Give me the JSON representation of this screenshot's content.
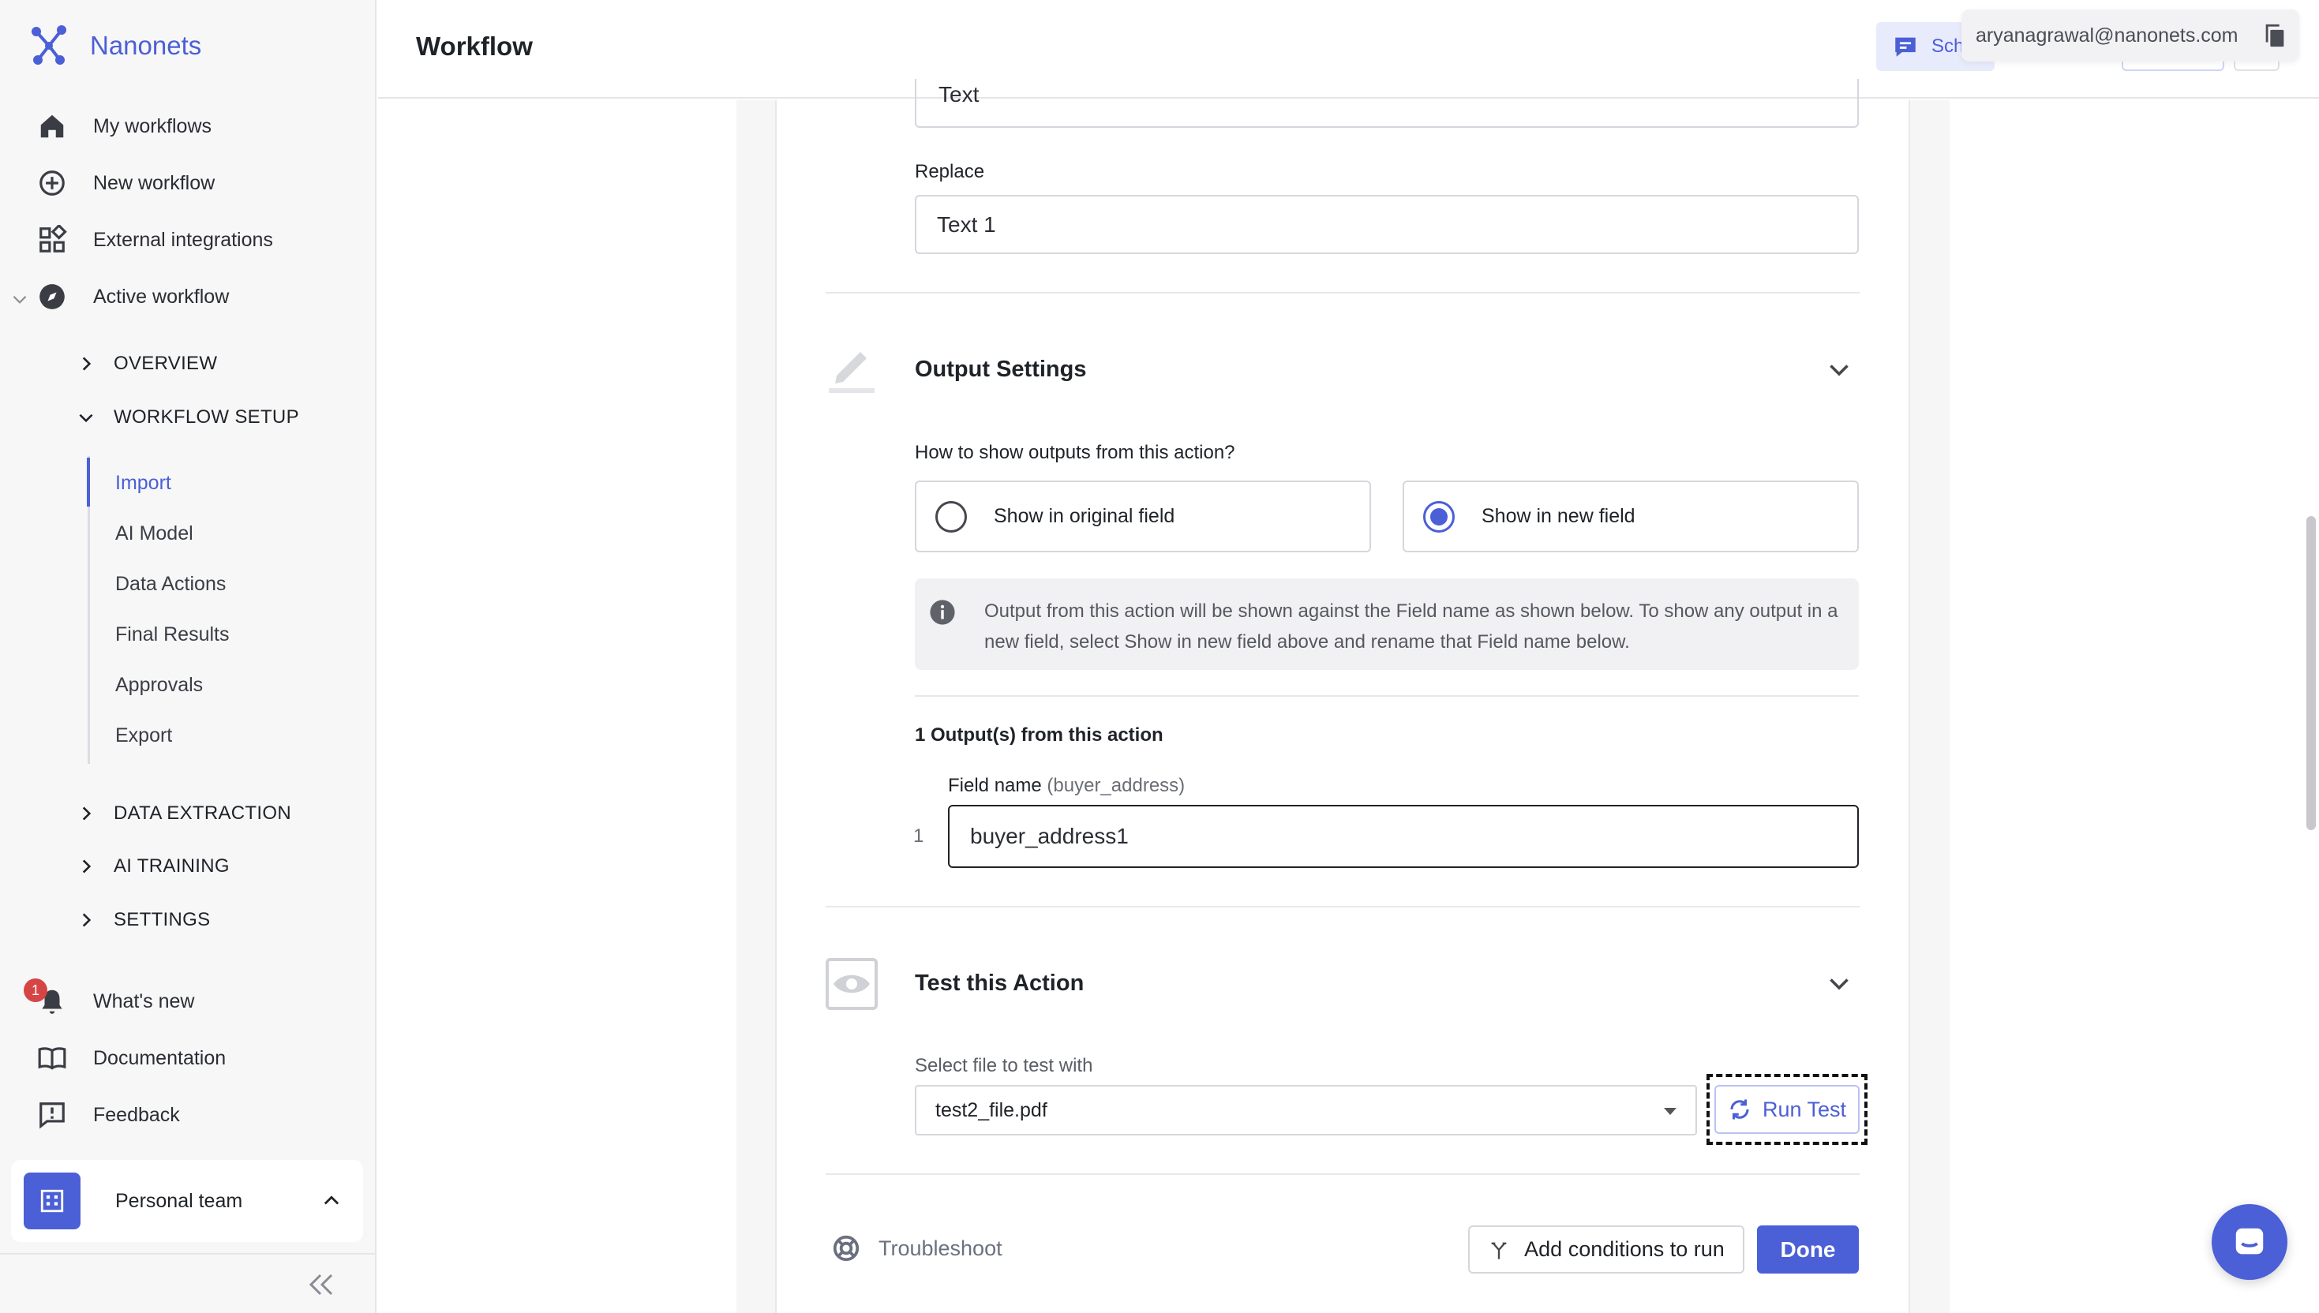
{
  "brand": {
    "name": "Nanonets"
  },
  "sidebar": {
    "main_items": [
      {
        "label": "My workflows",
        "icon": "home-icon"
      },
      {
        "label": "New workflow",
        "icon": "plus-circle-icon"
      },
      {
        "label": "External integrations",
        "icon": "integrations-icon"
      },
      {
        "label": "Active workflow",
        "icon": "compass-icon"
      }
    ],
    "sections": [
      {
        "label": "OVERVIEW",
        "expanded": false
      },
      {
        "label": "WORKFLOW SETUP",
        "expanded": true
      }
    ],
    "workflow_setup_items": [
      "Import",
      "AI Model",
      "Data Actions",
      "Final Results",
      "Approvals",
      "Export"
    ],
    "active_sub_item": "Import",
    "more_sections": [
      "DATA EXTRACTION",
      "AI TRAINING",
      "SETTINGS"
    ],
    "footer_items": [
      {
        "label": "What's new",
        "icon": "bell-icon",
        "badge": "1"
      },
      {
        "label": "Documentation",
        "icon": "book-icon"
      },
      {
        "label": "Feedback",
        "icon": "feedback-icon"
      }
    ],
    "team": {
      "name": "Personal team"
    }
  },
  "header": {
    "title": "Workflow",
    "schedule_label": "Sch",
    "user_email": "aryanagrawal@nanonets.com"
  },
  "action": {
    "find_value": "Text",
    "replace_label": "Replace",
    "replace_value": "Text 1",
    "output_settings": {
      "title": "Output Settings",
      "question": "How to show outputs from this action?",
      "options": [
        "Show in original field",
        "Show in new field"
      ],
      "selected": "Show in new field",
      "info": "Output from this action will be shown against the Field name as shown below. To show any output in a new field, select Show in new field above and rename that Field name below.",
      "outputs_count_label": "1 Output(s) from this action",
      "field_label": "Field name",
      "field_hint": "(buyer_address)",
      "row_number": "1",
      "field_value": "buyer_address1"
    },
    "test": {
      "title": "Test this Action",
      "select_label": "Select file to test with",
      "selected_file": "test2_file.pdf",
      "run_label": "Run Test"
    },
    "footer": {
      "troubleshoot_label": "Troubleshoot",
      "conditions_label": "Add conditions to run",
      "done_label": "Done"
    }
  },
  "colors": {
    "accent": "#4b5fd6",
    "badge": "#d64545"
  }
}
